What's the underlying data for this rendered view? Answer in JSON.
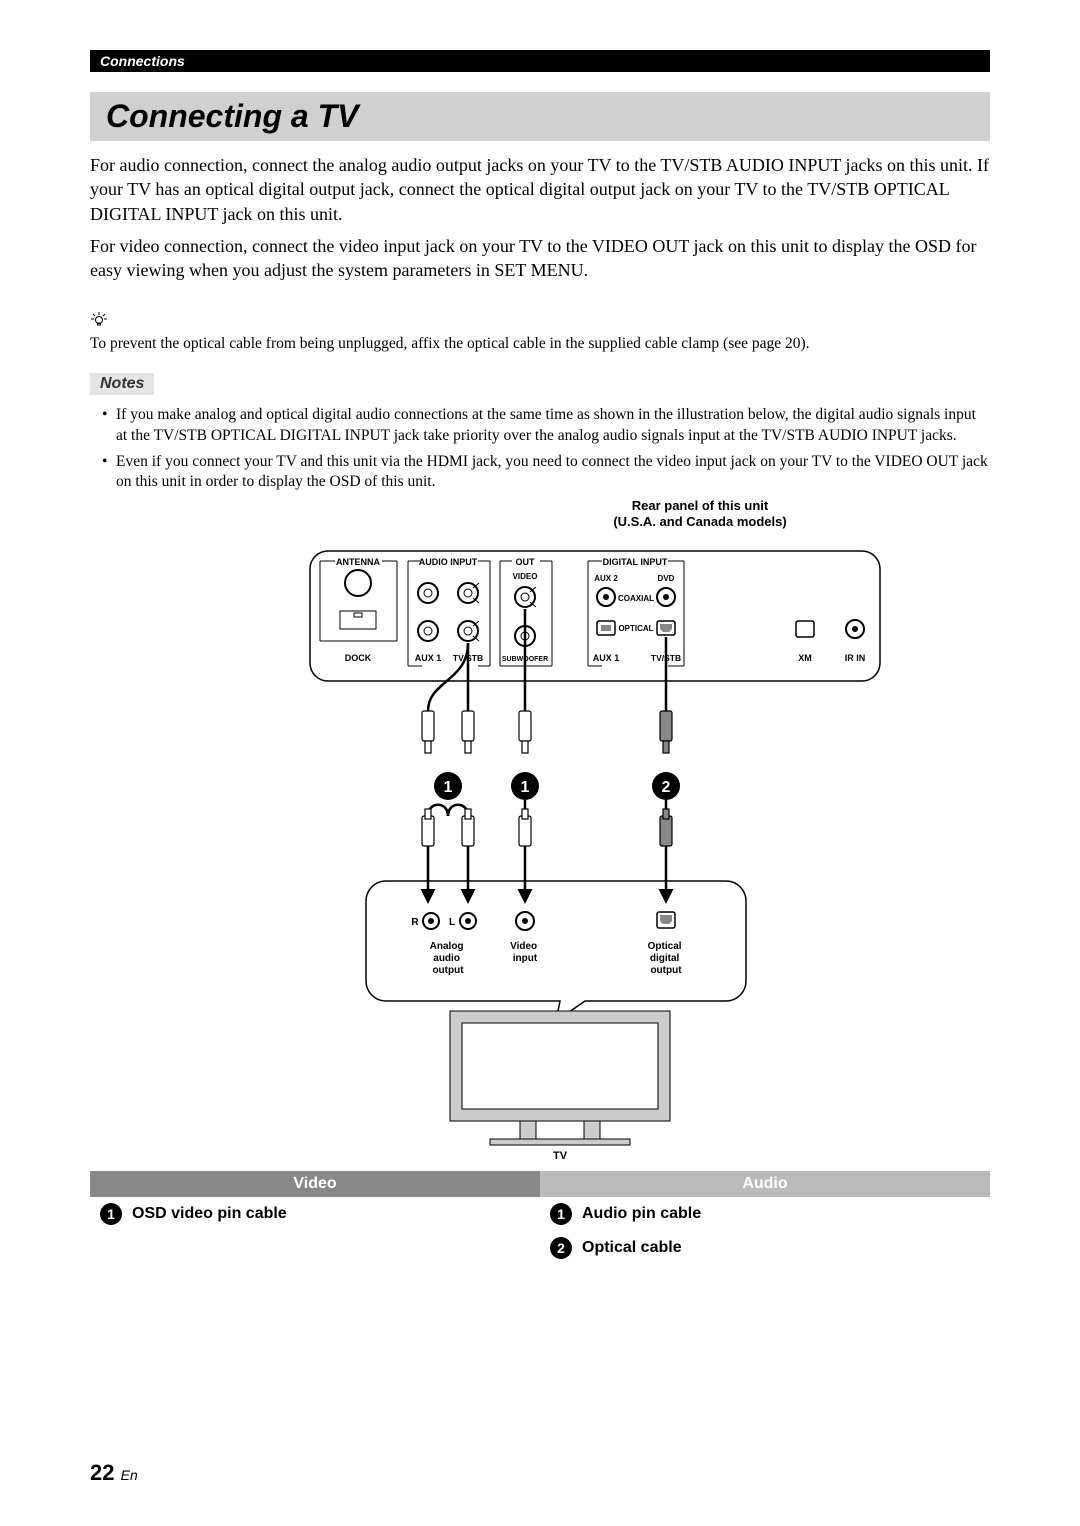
{
  "header": {
    "section": "Connections"
  },
  "title": "Connecting a TV",
  "paragraphs": {
    "p1": "For audio connection, connect the analog audio output jacks on your TV to the TV/STB AUDIO INPUT jacks on this unit. If your TV has an optical digital output jack, connect the optical digital output jack on your TV to the TV/STB OPTICAL DIGITAL INPUT jack on this unit.",
    "p2": "For video connection, connect the video input jack on your TV to the VIDEO OUT jack on this unit to display the OSD for easy viewing when you adjust the system parameters in SET MENU."
  },
  "tip": "To prevent the optical cable from being unplugged, affix the optical cable in the supplied cable clamp (see page 20).",
  "notes_label": "Notes",
  "notes": [
    "If you make analog and optical digital audio connections at the same time as shown in the illustration below, the digital audio signals input at the TV/STB OPTICAL DIGITAL INPUT jack take priority over the analog audio signals input at the TV/STB AUDIO INPUT jacks.",
    "Even if you connect your TV and this unit via the HDMI jack, you need to connect the video input jack on your TV to the VIDEO OUT jack on this unit in order to display the OSD of this unit."
  ],
  "diagram": {
    "panel_label_1": "Rear panel of this unit",
    "panel_label_2": "(U.S.A. and Canada models)",
    "labels": {
      "ANTENNA": "ANTENNA",
      "AUDIO_INPUT": "AUDIO INPUT",
      "OUT": "OUT",
      "VIDEO": "VIDEO",
      "DIGITAL_INPUT": "DIGITAL INPUT",
      "AUX2": "AUX 2",
      "DVD": "DVD",
      "COAXIAL": "COAXIAL",
      "OPTICAL": "OPTICAL",
      "DOCK": "DOCK",
      "AUX1": "AUX 1",
      "TVSTB": "TV/STB",
      "SUBWOOFER": "SUBWOOFER",
      "XM": "XM",
      "IRIN": "IR IN",
      "R": "R",
      "L": "L",
      "Analog_audio_output": "Analog\naudio\noutput",
      "Video_input": "Video\ninput",
      "Optical_digital_output": "Optical\ndigital\noutput",
      "TV": "TV"
    },
    "callouts": {
      "c1": "1",
      "c2": "1",
      "c3": "2"
    }
  },
  "legend": {
    "video_head": "Video",
    "audio_head": "Audio",
    "items": {
      "v1": {
        "num": "1",
        "label": "OSD video pin cable"
      },
      "a1": {
        "num": "1",
        "label": "Audio pin cable"
      },
      "a2": {
        "num": "2",
        "label": "Optical cable"
      }
    }
  },
  "page": {
    "num": "22",
    "lang": "En"
  }
}
